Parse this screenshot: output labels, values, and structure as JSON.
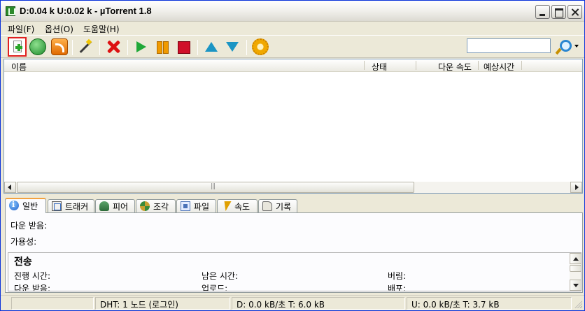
{
  "window": {
    "title": "D:0.04 k U:0.02 k - µTorrent 1.8"
  },
  "menu": {
    "items": [
      {
        "label": "파일(F)"
      },
      {
        "label": "옵션(O)"
      },
      {
        "label": "도움말(H)"
      }
    ]
  },
  "toolbar": {
    "buttons": [
      {
        "name": "add-torrent",
        "icon": "add-torrent-icon"
      },
      {
        "name": "add-url",
        "icon": "globe-icon"
      },
      {
        "name": "rss",
        "icon": "rss-icon"
      },
      {
        "name": "create-torrent",
        "icon": "magic-wand-icon"
      },
      {
        "name": "remove",
        "icon": "red-x-icon"
      },
      {
        "name": "start",
        "icon": "play-icon"
      },
      {
        "name": "pause",
        "icon": "pause-icon"
      },
      {
        "name": "stop",
        "icon": "stop-icon"
      },
      {
        "name": "move-up",
        "icon": "up-arrow-icon"
      },
      {
        "name": "move-down",
        "icon": "down-arrow-icon"
      },
      {
        "name": "preferences",
        "icon": "gear-icon"
      }
    ],
    "highlight_color": "#e02020",
    "search": {
      "value": "",
      "placeholder": ""
    }
  },
  "torrent_list": {
    "columns": [
      {
        "label": "이름"
      },
      {
        "label": "상태"
      },
      {
        "label": "다운 속도"
      },
      {
        "label": "예상시간"
      }
    ],
    "rows": []
  },
  "tabs": [
    {
      "label": "일반",
      "icon": "info-icon",
      "active": true
    },
    {
      "label": "트래커",
      "icon": "tracker-icon",
      "active": false
    },
    {
      "label": "피어",
      "icon": "peers-icon",
      "active": false
    },
    {
      "label": "조각",
      "icon": "pieces-icon",
      "active": false
    },
    {
      "label": "파일",
      "icon": "files-icon",
      "active": false
    },
    {
      "label": "속도",
      "icon": "speed-icon",
      "active": false
    },
    {
      "label": "기록",
      "icon": "log-icon",
      "active": false
    }
  ],
  "details": {
    "downloaded_label": "다운 받음:",
    "availability_label": "가용성:",
    "transfer": {
      "title": "전송",
      "elapsed_label": "진행 시간:",
      "remaining_label": "남은 시간:",
      "wasted_label": "버림:",
      "downloaded_label": "다운 받음:",
      "uploaded_label": "업로드:",
      "seeds_label": "배포:"
    }
  },
  "statusbar": {
    "dht": "DHT: 1 노드  (로그인)",
    "download": "D: 0.0 kB/초 T: 6.0 kB",
    "upload": "U: 0.0 kB/초 T: 3.7 kB"
  }
}
